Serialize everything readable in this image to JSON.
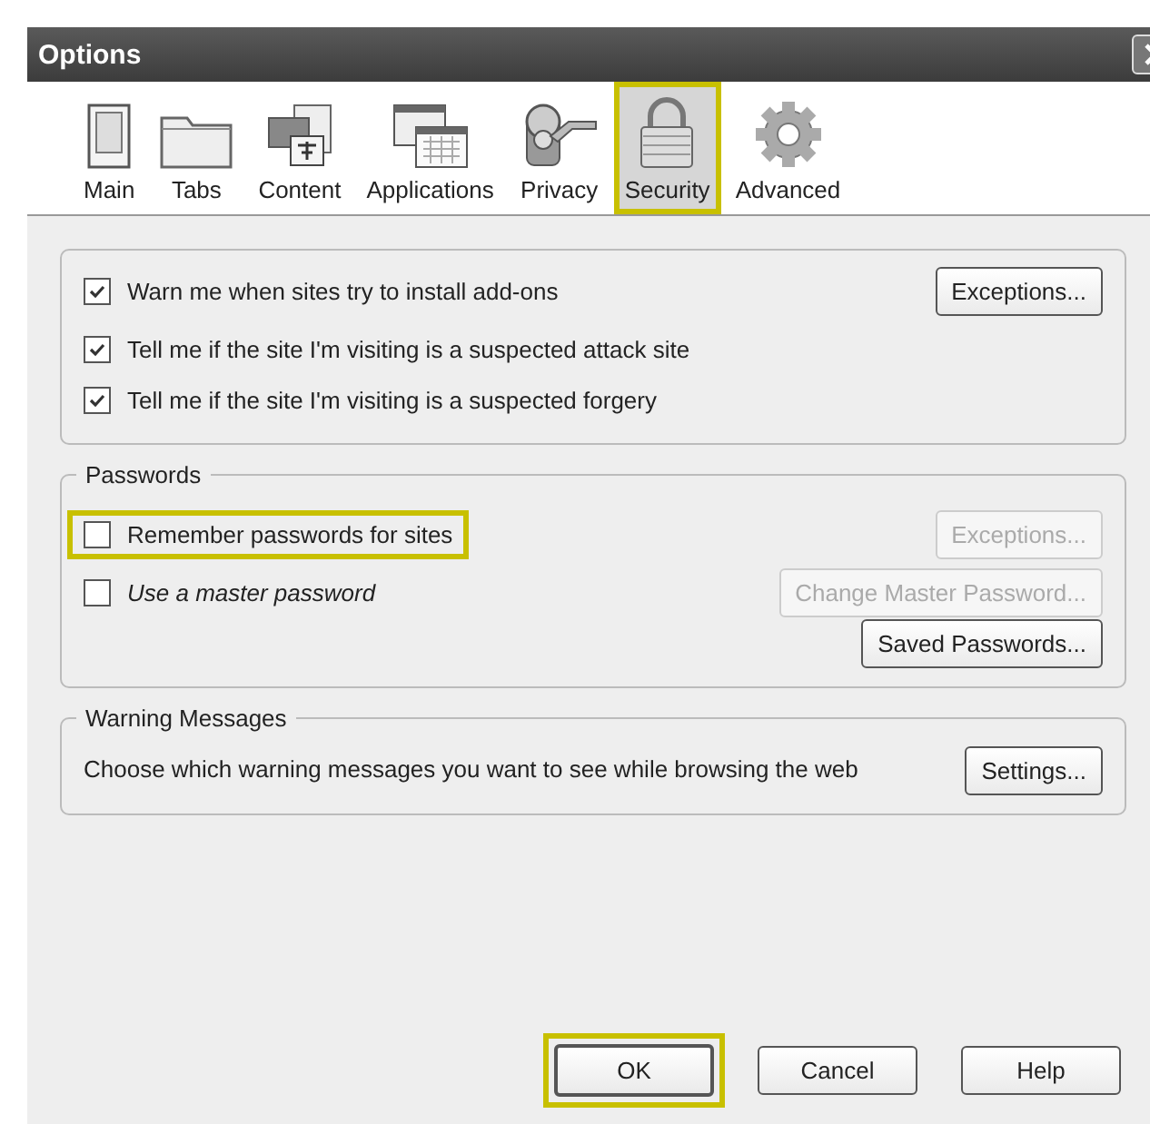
{
  "window": {
    "title": "Options"
  },
  "tabs": [
    {
      "label": "Main",
      "selected": false,
      "highlighted": false
    },
    {
      "label": "Tabs",
      "selected": false,
      "highlighted": false
    },
    {
      "label": "Content",
      "selected": false,
      "highlighted": false
    },
    {
      "label": "Applications",
      "selected": false,
      "highlighted": false
    },
    {
      "label": "Privacy",
      "selected": false,
      "highlighted": false
    },
    {
      "label": "Security",
      "selected": true,
      "highlighted": true
    },
    {
      "label": "Advanced",
      "selected": false,
      "highlighted": false
    }
  ],
  "security": {
    "options": [
      {
        "label": "Warn me when sites try to install add-ons",
        "checked": true,
        "button": {
          "label": "Exceptions...",
          "disabled": false
        }
      },
      {
        "label": "Tell me if the site I'm visiting is a suspected attack site",
        "checked": true
      },
      {
        "label": "Tell me if the site I'm visiting is a suspected forgery",
        "checked": true
      }
    ]
  },
  "passwords": {
    "title": "Passwords",
    "options": [
      {
        "label": "Remember passwords for sites",
        "checked": false,
        "highlighted": true,
        "italic": false,
        "button": {
          "label": "Exceptions...",
          "disabled": true
        }
      },
      {
        "label": "Use a master password",
        "checked": false,
        "highlighted": false,
        "italic": true,
        "button": {
          "label": "Change Master Password...",
          "disabled": true
        }
      }
    ],
    "saved_button": {
      "label": "Saved Passwords...",
      "disabled": false
    }
  },
  "warning_messages": {
    "title": "Warning Messages",
    "description": "Choose which warning messages you want to see while browsing the web",
    "button": {
      "label": "Settings..."
    }
  },
  "footer_buttons": [
    {
      "label": "OK",
      "highlighted": true
    },
    {
      "label": "Cancel",
      "highlighted": false
    },
    {
      "label": "Help",
      "highlighted": false
    }
  ]
}
